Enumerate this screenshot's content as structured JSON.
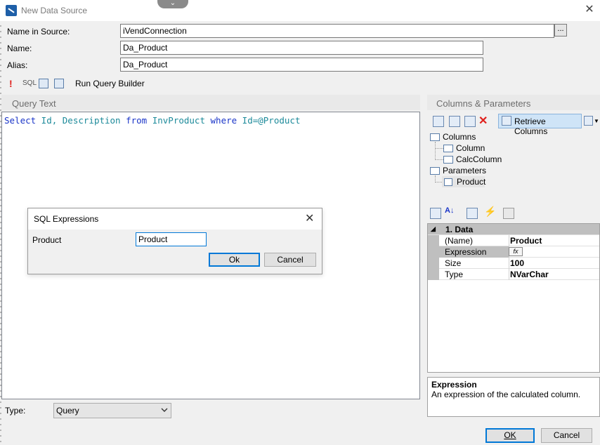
{
  "window": {
    "title": "New Data Source"
  },
  "form": {
    "name_in_source_label": "Name in Source:",
    "name_in_source_value": "iVendConnection",
    "ellipsis_label": "...",
    "name_label": "Name:",
    "name_value": "Da_Product",
    "alias_label": "Alias:",
    "alias_value": "Da_Product"
  },
  "toolbar": {
    "sql_label": "SQL",
    "run_query_builder_label": "Run Query Builder"
  },
  "query_panel": {
    "header": "Query Text",
    "code": {
      "select": "Select",
      "cols": " Id, Description ",
      "from": "from",
      "table": " InvProduct ",
      "where": "where",
      "cond": " Id=@Product"
    }
  },
  "sql_dialog": {
    "title": "SQL Expressions",
    "field_label": "Product",
    "field_value": "Product",
    "ok_label": "Ok",
    "cancel_label": "Cancel"
  },
  "columns_panel": {
    "header": "Columns & Parameters",
    "retrieve_label": "Retrieve Columns",
    "tree": {
      "columns": "Columns",
      "column": "Column",
      "calc_column": "CalcColumn",
      "parameters": "Parameters",
      "product": "Product"
    }
  },
  "property_grid": {
    "category": "1. Data",
    "rows": [
      {
        "name": "(Name)",
        "value": "Product"
      },
      {
        "name": "Expression",
        "value": ""
      },
      {
        "name": "Size",
        "value": "100"
      },
      {
        "name": "Type",
        "value": "NVarChar"
      }
    ],
    "expression_icon_text": "fx"
  },
  "description": {
    "title": "Expression",
    "text": "An expression of the calculated column."
  },
  "type_field": {
    "label": "Type:",
    "value": "Query"
  },
  "footer": {
    "ok_label": "OK",
    "cancel_label": "Cancel"
  }
}
